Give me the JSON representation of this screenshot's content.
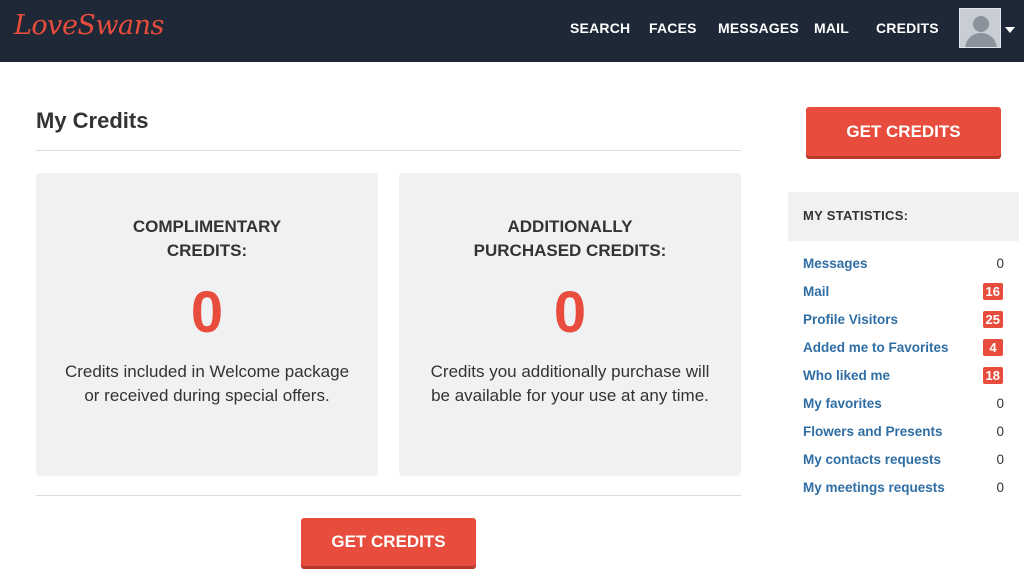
{
  "app": {
    "logo_text": "LoveSwans",
    "brand_color": "#e74c3c",
    "header_bg": "#1e2836",
    "link_color": "#2f6ea5"
  },
  "nav": {
    "items": [
      {
        "label": "SEARCH"
      },
      {
        "label": "FACES"
      },
      {
        "label": "MESSAGES"
      },
      {
        "label": "MAIL"
      },
      {
        "label": "CREDITS"
      }
    ],
    "avatar_icon": "user-avatar-icon",
    "menu_icon": "caret-down-icon"
  },
  "main": {
    "title": "My Credits",
    "cards": [
      {
        "title": "COMPLIMENTARY CREDITS:",
        "value": "0",
        "description": "Credits included in Welcome package or received during special offers."
      },
      {
        "title": "ADDITIONALLY PURCHASED CREDITS:",
        "value": "0",
        "description": "Credits you additionally purchase will be available for your use at any time."
      }
    ],
    "get_credits_label": "GET CREDITS"
  },
  "sidebar": {
    "get_credits_label": "GET CREDITS",
    "stats_title": "MY STATISTICS:",
    "stats": [
      {
        "label": "Messages",
        "count": "0",
        "highlight": false
      },
      {
        "label": "Mail",
        "count": "16",
        "highlight": true
      },
      {
        "label": "Profile Visitors",
        "count": "25",
        "highlight": true
      },
      {
        "label": "Added me to Favorites",
        "count": "4",
        "highlight": true
      },
      {
        "label": "Who liked me",
        "count": "18",
        "highlight": true
      },
      {
        "label": "My favorites",
        "count": "0",
        "highlight": false
      },
      {
        "label": "Flowers and Presents",
        "count": "0",
        "highlight": false
      },
      {
        "label": "My contacts requests",
        "count": "0",
        "highlight": false
      },
      {
        "label": "My meetings requests",
        "count": "0",
        "highlight": false
      }
    ]
  }
}
